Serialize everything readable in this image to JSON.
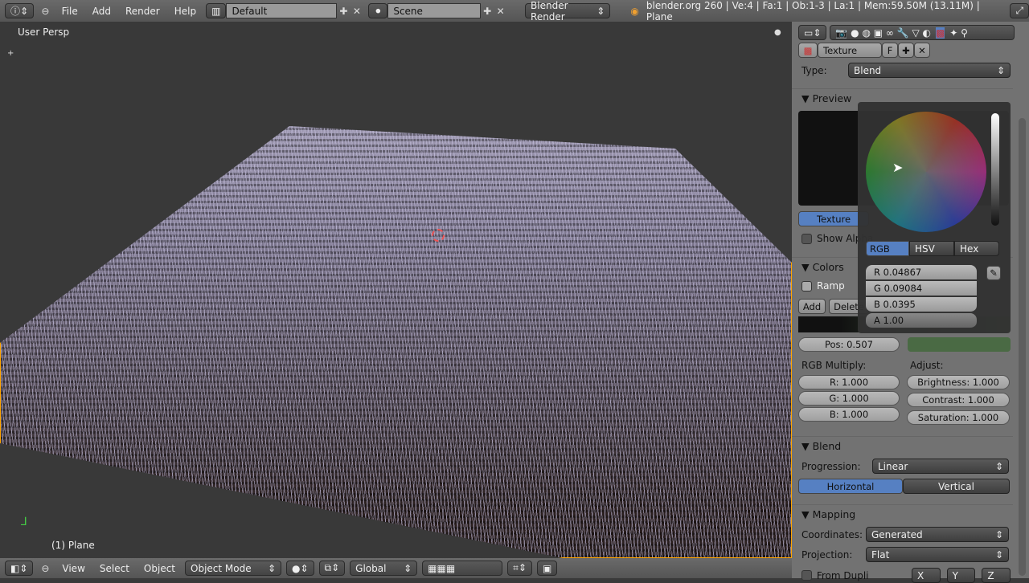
{
  "topbar": {
    "menus": [
      "File",
      "Add",
      "Render",
      "Help"
    ],
    "layout": "Default",
    "scene": "Scene",
    "engine": "Blender Render",
    "info": "blender.org 260 | Ve:4 | Fa:1 | Ob:1-3 | La:1 | Mem:59.50M (13.11M) | Plane"
  },
  "viewport": {
    "view_label": "User Persp",
    "object_label": "(1) Plane"
  },
  "bottombar": {
    "menus": [
      "View",
      "Select",
      "Object"
    ],
    "mode": "Object Mode",
    "orientation": "Global"
  },
  "props": {
    "texture_name": "Texture",
    "fake_user": "F",
    "type_label": "Type:",
    "type_value": "Blend",
    "preview_header": "Preview",
    "texture_tab": "Texture",
    "show_alpha": "Show Alpha",
    "colors_header": "Colors",
    "ramp": "Ramp",
    "add": "Add",
    "delete": "Delete",
    "pos": "Pos: 0.507",
    "rgb_multiply": "RGB Multiply:",
    "adjust": "Adjust:",
    "r": "R: 1.000",
    "g": "G: 1.000",
    "b": "B: 1.000",
    "brightness": "Brightness: 1.000",
    "contrast": "Contrast: 1.000",
    "saturation": "Saturation: 1.000",
    "blend_header": "Blend",
    "progression_label": "Progression:",
    "progression": "Linear",
    "horizontal": "Horizontal",
    "vertical": "Vertical",
    "mapping_header": "Mapping",
    "coordinates_label": "Coordinates:",
    "coordinates": "Generated",
    "projection_label": "Projection:",
    "projection": "Flat",
    "from_dupli": "From Dupli",
    "x": "X",
    "y": "Y",
    "z": "Z"
  },
  "picker": {
    "tabs": [
      "RGB",
      "HSV",
      "Hex"
    ],
    "r": "R 0.04867",
    "g": "G 0.09084",
    "b": "B 0.0395",
    "a": "A 1.00"
  },
  "colors": {
    "ramp_color": "#4a6a44",
    "selection": "#5680c2"
  }
}
